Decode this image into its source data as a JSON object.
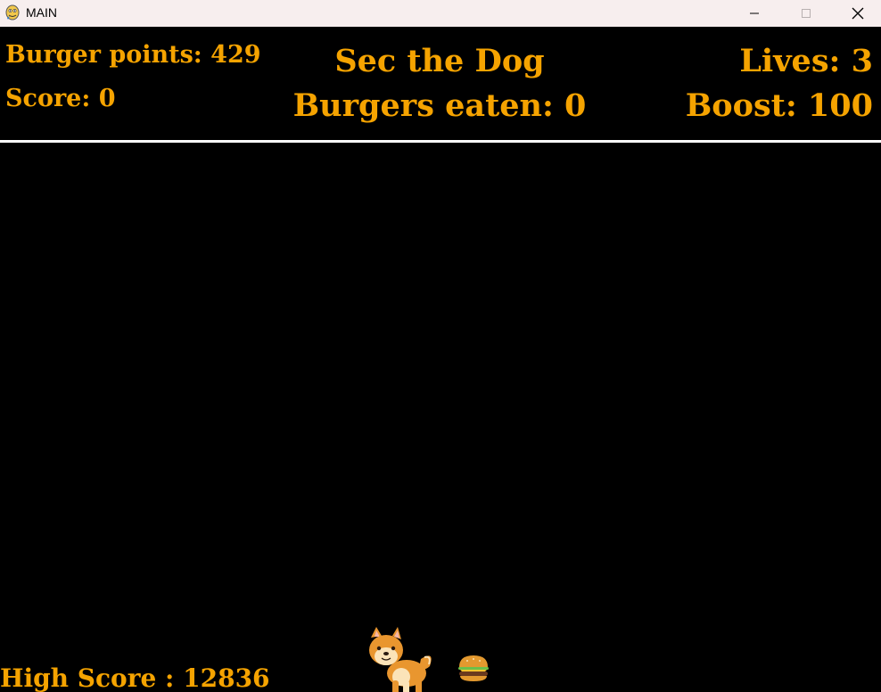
{
  "window": {
    "title": "MAIN",
    "icon": "pygame-snake-icon"
  },
  "hud": {
    "burger_points": "Burger points: 429",
    "score": "Score: 0",
    "game_title": "Sec the Dog",
    "burgers_eaten": "Burgers eaten: 0",
    "lives": "Lives: 3",
    "boost": "Boost: 100",
    "high_score": "High Score : 12836"
  },
  "sprites": {
    "player": "shiba-dog-sprite",
    "item": "burger-sprite"
  },
  "colors": {
    "hud_text": "#f5a300",
    "background": "#000000",
    "divider": "#ffffff",
    "titlebar": "#f7eeee"
  }
}
